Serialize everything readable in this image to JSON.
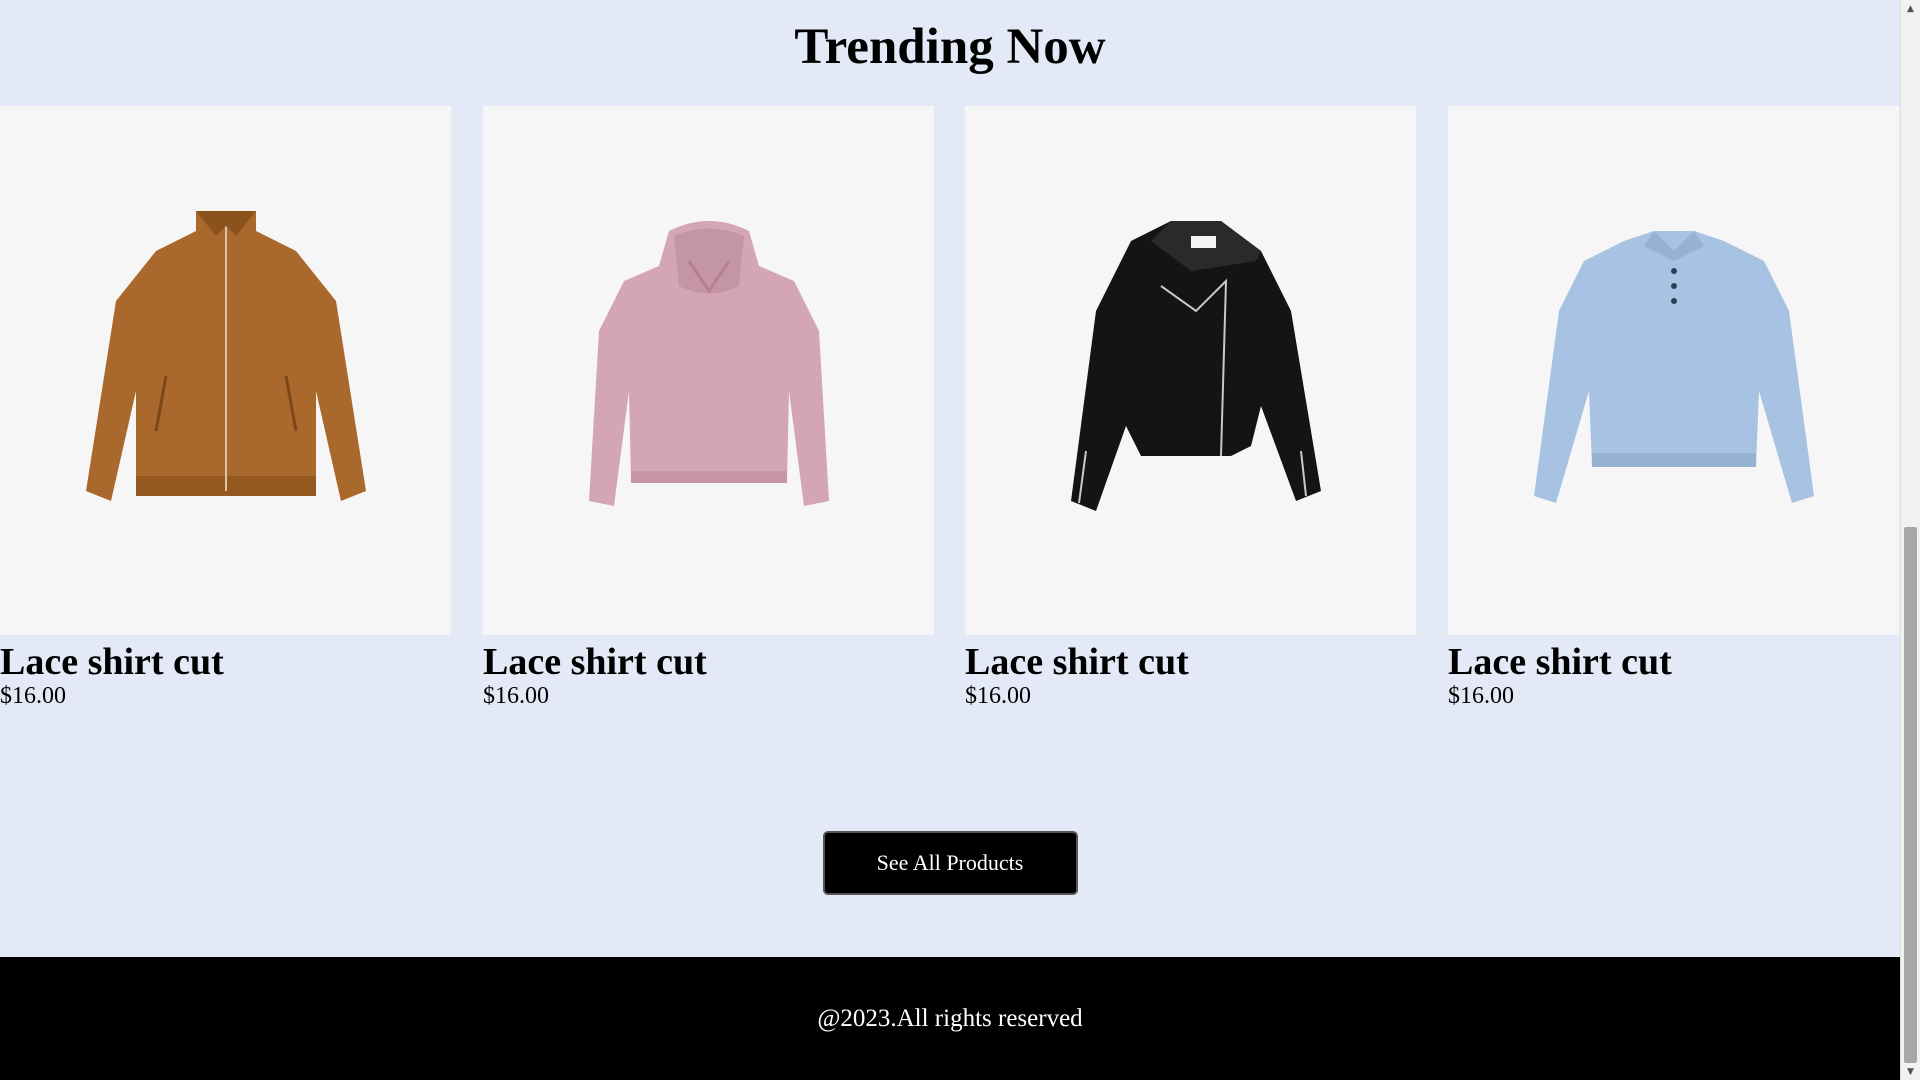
{
  "section": {
    "title": "Trending Now"
  },
  "products": [
    {
      "name": "Lace shirt cut",
      "price": "$16.00",
      "image": "brown-suede-zip-jacket",
      "color": "#a9692c"
    },
    {
      "name": "Lace shirt cut",
      "price": "$16.00",
      "image": "pink-knit-hoodie",
      "color": "#d4a6b3"
    },
    {
      "name": "Lace shirt cut",
      "price": "$16.00",
      "image": "black-biker-jacket",
      "color": "#141414"
    },
    {
      "name": "Lace shirt cut",
      "price": "$16.00",
      "image": "light-blue-polo-sweater",
      "color": "#a7c2e2"
    }
  ],
  "cta": {
    "label": "See All Products"
  },
  "footer": {
    "text": "@2023.All rights reserved"
  },
  "colors": {
    "background": "#e4e9f7",
    "card_bg": "#f6f6f6",
    "footer_bg": "#000000",
    "button_bg": "#000000"
  }
}
